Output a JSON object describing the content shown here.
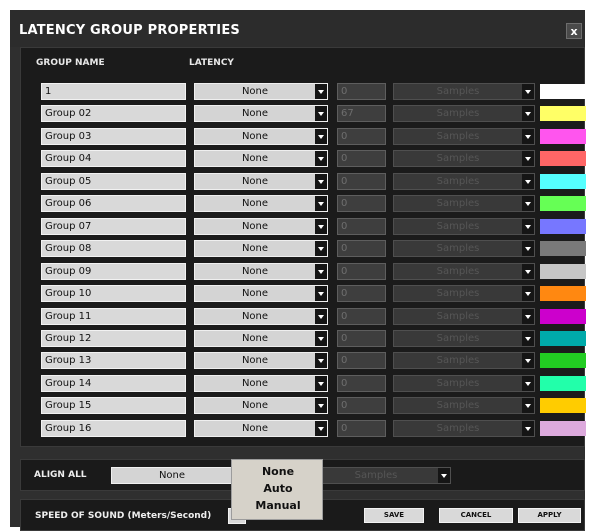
{
  "dialog": {
    "title": "LATENCY GROUP PROPERTIES",
    "close_label": "x",
    "headers": {
      "group_name": "GROUP NAME",
      "latency": "LATENCY"
    }
  },
  "rows": [
    {
      "name": "1",
      "latency": "None",
      "value": "0",
      "unit": "Samples",
      "color": "#ffffff"
    },
    {
      "name": "Group 02",
      "latency": "None",
      "value": "67",
      "unit": "Samples",
      "color": "#ffff66"
    },
    {
      "name": "Group 03",
      "latency": "None",
      "value": "0",
      "unit": "Samples",
      "color": "#ff55ee"
    },
    {
      "name": "Group 04",
      "latency": "None",
      "value": "0",
      "unit": "Samples",
      "color": "#ff6666"
    },
    {
      "name": "Group 05",
      "latency": "None",
      "value": "0",
      "unit": "Samples",
      "color": "#55ffff"
    },
    {
      "name": "Group 06",
      "latency": "None",
      "value": "0",
      "unit": "Samples",
      "color": "#66ff55"
    },
    {
      "name": "Group 07",
      "latency": "None",
      "value": "0",
      "unit": "Samples",
      "color": "#7777ff"
    },
    {
      "name": "Group 08",
      "latency": "None",
      "value": "0",
      "unit": "Samples",
      "color": "#7a7a7a"
    },
    {
      "name": "Group 09",
      "latency": "None",
      "value": "0",
      "unit": "Samples",
      "color": "#c6c6c6"
    },
    {
      "name": "Group 10",
      "latency": "None",
      "value": "0",
      "unit": "Samples",
      "color": "#ff8811"
    },
    {
      "name": "Group 11",
      "latency": "None",
      "value": "0",
      "unit": "Samples",
      "color": "#cc00cc"
    },
    {
      "name": "Group 12",
      "latency": "None",
      "value": "0",
      "unit": "Samples",
      "color": "#00aaaa"
    },
    {
      "name": "Group 13",
      "latency": "None",
      "value": "0",
      "unit": "Samples",
      "color": "#22cc22"
    },
    {
      "name": "Group 14",
      "latency": "None",
      "value": "0",
      "unit": "Samples",
      "color": "#22ffaa"
    },
    {
      "name": "Group 15",
      "latency": "None",
      "value": "0",
      "unit": "Samples",
      "color": "#ffcc00"
    },
    {
      "name": "Group 16",
      "latency": "None",
      "value": "0",
      "unit": "Samples",
      "color": "#ddaadd"
    }
  ],
  "align_all": {
    "label": "ALIGN ALL",
    "latency": "None",
    "unit": "Samples"
  },
  "speed": {
    "label": "SPEED OF SOUND (Meters/Second)",
    "value": "34"
  },
  "buttons": {
    "save": "SAVE",
    "cancel": "CANCEL",
    "apply": "APPLY"
  },
  "dropdown_menu": {
    "options": [
      "None",
      "Auto",
      "Manual"
    ]
  }
}
